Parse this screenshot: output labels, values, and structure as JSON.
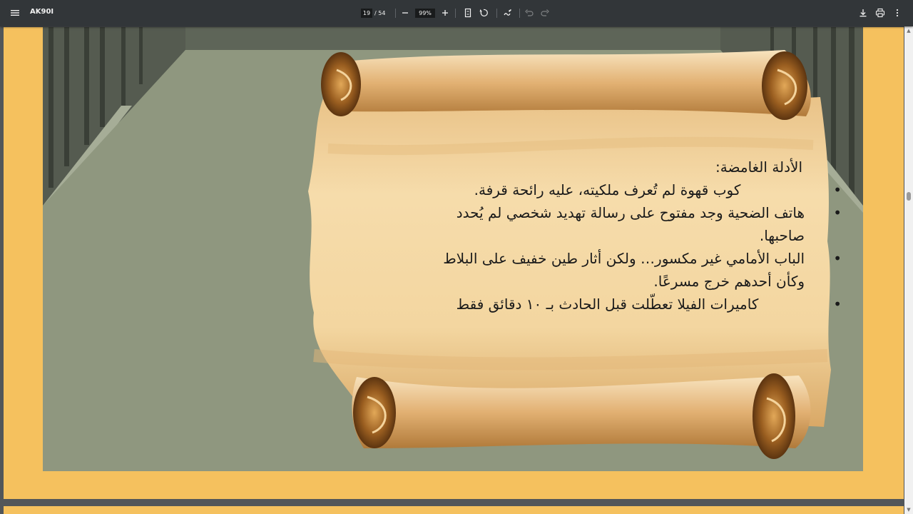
{
  "toolbar": {
    "menu_icon": "hamburger-menu-icon",
    "title": "AK90I",
    "page_current": "19",
    "page_total": "/ 54",
    "zoom": "99%",
    "icons": [
      "zoom-out-icon",
      "zoom-in-icon",
      "fit-page-icon",
      "rotate-icon",
      "annotate-icon",
      "undo-icon",
      "redo-icon",
      "download-icon",
      "print-icon",
      "more-options-icon"
    ]
  },
  "slide": {
    "heading": "الأدلة الغامضة:",
    "items": [
      "كوب قهوة لم تُعرف ملكيته، عليه رائحة قرفة.",
      "هاتف الضحية وجد مفتوح على رسالة تهديد شخصي لم يُحدد صاحبها.",
      "الباب الأمامي غير مكسور… ولكن أثار طين خفيف على البلاط وكأن أحدهم خرج مسرعًا.",
      "كاميرات الفيلا تعطّلت قبل الحادث بـ ١٠ دقائق فقط"
    ]
  },
  "colors": {
    "toolbar_bg": "#323639",
    "page_bg": "#f5c15e",
    "wall": "#8f977e",
    "parchment": "#efcf96",
    "scroll_dark": "#8a5a22"
  }
}
